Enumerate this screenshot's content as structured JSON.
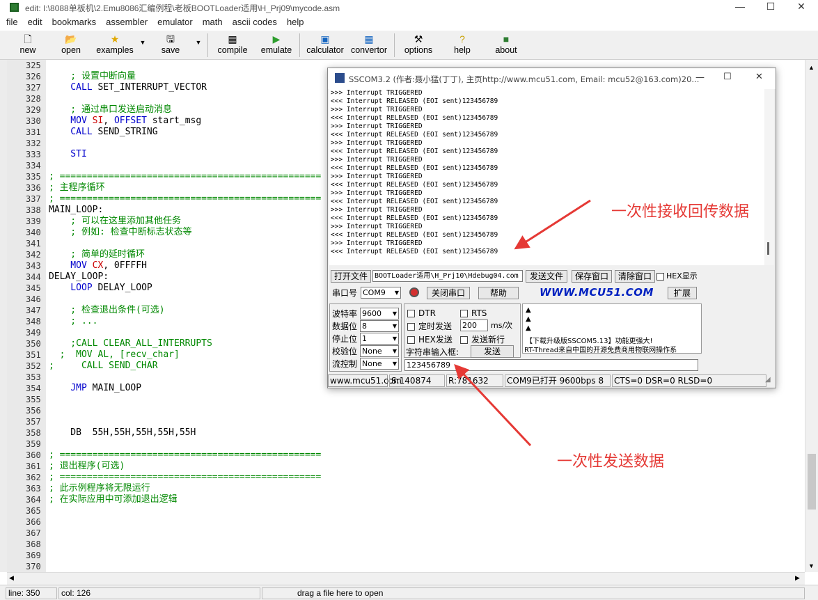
{
  "window": {
    "title": "edit: I:\\8088单板机\\2.Emu8086汇编例程\\老板BOOTLoader适用\\H_Prj09\\mycode.asm"
  },
  "menu": [
    "file",
    "edit",
    "bookmarks",
    "assembler",
    "emulator",
    "math",
    "ascii codes",
    "help"
  ],
  "toolbar": {
    "new": "new",
    "open": "open",
    "examples": "examples",
    "save": "save",
    "compile": "compile",
    "emulate": "emulate",
    "calculator": "calculator",
    "convertor": "convertor",
    "options": "options",
    "help": "help",
    "about": "about"
  },
  "line_numbers": [
    "325",
    "326",
    "327",
    "328",
    "329",
    "330",
    "331",
    "332",
    "333",
    "334",
    "335",
    "336",
    "337",
    "338",
    "339",
    "340",
    "341",
    "342",
    "343",
    "344",
    "345",
    "346",
    "347",
    "348",
    "349",
    "350",
    "351",
    "352",
    "353",
    "354",
    "355",
    "356",
    "357",
    "358",
    "359",
    "360",
    "361",
    "362",
    "363",
    "364",
    "365",
    "366",
    "367",
    "368",
    "369",
    "370"
  ],
  "code": [
    {
      "parts": []
    },
    {
      "parts": [
        {
          "t": "    ; 设置中断向量",
          "c": "cm"
        }
      ]
    },
    {
      "parts": [
        {
          "t": "    CALL ",
          "c": "kw"
        },
        {
          "t": "SET_INTERRUPT_VECTOR",
          "c": "lb"
        }
      ]
    },
    {
      "parts": []
    },
    {
      "parts": [
        {
          "t": "    ; 通过串口发送启动消息",
          "c": "cm"
        }
      ]
    },
    {
      "parts": [
        {
          "t": "    MOV ",
          "c": "kw"
        },
        {
          "t": "SI",
          "c": "rg"
        },
        {
          "t": ", ",
          "c": "lb"
        },
        {
          "t": "OFFSET ",
          "c": "kw"
        },
        {
          "t": "start_msg",
          "c": "lb"
        }
      ]
    },
    {
      "parts": [
        {
          "t": "    CALL ",
          "c": "kw"
        },
        {
          "t": "SEND_STRING",
          "c": "lb"
        }
      ]
    },
    {
      "parts": []
    },
    {
      "parts": [
        {
          "t": "    STI",
          "c": "kw"
        }
      ]
    },
    {
      "parts": []
    },
    {
      "parts": [
        {
          "t": "; ================================================",
          "c": "cm"
        }
      ]
    },
    {
      "parts": [
        {
          "t": "; 主程序循环",
          "c": "cm"
        }
      ]
    },
    {
      "parts": [
        {
          "t": "; ================================================",
          "c": "cm"
        }
      ]
    },
    {
      "parts": [
        {
          "t": "MAIN_LOOP:",
          "c": "lb"
        }
      ]
    },
    {
      "parts": [
        {
          "t": "    ; 可以在这里添加其他任务",
          "c": "cm"
        }
      ]
    },
    {
      "parts": [
        {
          "t": "    ; 例如: 检查中断标志状态等",
          "c": "cm"
        }
      ]
    },
    {
      "parts": []
    },
    {
      "parts": [
        {
          "t": "    ; 简单的延时循环",
          "c": "cm"
        }
      ]
    },
    {
      "parts": [
        {
          "t": "    MOV ",
          "c": "kw"
        },
        {
          "t": "CX",
          "c": "rg"
        },
        {
          "t": ", 0FFFFH",
          "c": "lb"
        }
      ]
    },
    {
      "parts": [
        {
          "t": "DELAY_LOOP:",
          "c": "lb"
        }
      ]
    },
    {
      "parts": [
        {
          "t": "    LOOP ",
          "c": "kw"
        },
        {
          "t": "DELAY_LOOP",
          "c": "lb"
        }
      ]
    },
    {
      "parts": []
    },
    {
      "parts": [
        {
          "t": "    ; 检查退出条件(可选)",
          "c": "cm"
        }
      ]
    },
    {
      "parts": [
        {
          "t": "    ; ...",
          "c": "cm"
        }
      ]
    },
    {
      "parts": []
    },
    {
      "parts": [
        {
          "t": "    ;CALL CLEAR_ALL_INTERRUPTS",
          "c": "cm"
        }
      ]
    },
    {
      "parts": [
        {
          "t": "  ;  MOV AL, [recv_char]",
          "c": "cm"
        }
      ]
    },
    {
      "parts": [
        {
          "t": ";     CALL SEND_CHAR",
          "c": "cm"
        }
      ]
    },
    {
      "parts": []
    },
    {
      "parts": [
        {
          "t": "    JMP ",
          "c": "kw"
        },
        {
          "t": "MAIN_LOOP",
          "c": "lb"
        }
      ]
    },
    {
      "parts": []
    },
    {
      "parts": []
    },
    {
      "parts": []
    },
    {
      "parts": [
        {
          "t": "    DB  55H,55H,55H,55H,55H",
          "c": "lb"
        }
      ]
    },
    {
      "parts": []
    },
    {
      "parts": [
        {
          "t": "; ================================================",
          "c": "cm"
        }
      ]
    },
    {
      "parts": [
        {
          "t": "; 退出程序(可选)",
          "c": "cm"
        }
      ]
    },
    {
      "parts": [
        {
          "t": "; ================================================",
          "c": "cm"
        }
      ]
    },
    {
      "parts": [
        {
          "t": "; 此示例程序将无限运行",
          "c": "cm"
        }
      ]
    },
    {
      "parts": [
        {
          "t": "; 在实际应用中可添加退出逻辑",
          "c": "cm"
        }
      ]
    },
    {
      "parts": []
    },
    {
      "parts": []
    },
    {
      "parts": []
    },
    {
      "parts": []
    },
    {
      "parts": []
    },
    {
      "parts": []
    }
  ],
  "status": {
    "line": "line: 350",
    "col": "col: 126",
    "hint": "drag a file here to open"
  },
  "sscom": {
    "title": "SSCOM3.2 (作者:聂小猛(丁丁), 主页http://www.mcu51.com,  Email: mcu52@163.com)20...",
    "log_lines": [
      ">>> Interrupt TRIGGERED",
      "<<< Interrupt RELEASED (EOI sent)123456789",
      ">>> Interrupt TRIGGERED",
      "<<< Interrupt RELEASED (EOI sent)123456789",
      ">>> Interrupt TRIGGERED",
      "<<< Interrupt RELEASED (EOI sent)123456789",
      ">>> Interrupt TRIGGERED",
      "<<< Interrupt RELEASED (EOI sent)123456789",
      ">>> Interrupt TRIGGERED",
      "<<< Interrupt RELEASED (EOI sent)123456789",
      ">>> Interrupt TRIGGERED",
      "<<< Interrupt RELEASED (EOI sent)123456789",
      ">>> Interrupt TRIGGERED",
      "<<< Interrupt RELEASED (EOI sent)123456789",
      ">>> Interrupt TRIGGERED",
      "<<< Interrupt RELEASED (EOI sent)123456789",
      ">>> Interrupt TRIGGERED",
      "<<< Interrupt RELEASED (EOI sent)123456789",
      ">>> Interrupt TRIGGERED",
      "<<< Interrupt RELEASED (EOI sent)123456789"
    ],
    "open_file": "打开文件",
    "file_path": "BOOTLoader适用\\H_Prj10\\Hdebug04.com",
    "send_file": "发送文件",
    "save_window": "保存窗口",
    "clear_window": "清除窗口",
    "hex_display": "HEX显示",
    "port_label": "串口号",
    "port_value": "COM9",
    "close_port": "关闭串口",
    "help": "帮助",
    "site": "WWW.MCU51.COM",
    "expand": "扩展",
    "baud_label": "波特率",
    "baud_value": "9600",
    "databits_label": "数据位",
    "databits_value": "8",
    "stopbits_label": "停止位",
    "stopbits_value": "1",
    "parity_label": "校验位",
    "parity_value": "None",
    "flow_label": "流控制",
    "flow_value": "None",
    "dtr": "DTR",
    "rts": "RTS",
    "timed_send": "定时发送",
    "interval": "200",
    "interval_unit": "ms/次",
    "hex_send": "HEX发送",
    "send_newline": "发送新行",
    "input_label": "字符串输入框:",
    "send": "发送",
    "input_value": "123456789",
    "info1": "【下载升级版SSCOM5.13】功能更强大!",
    "info2": "RT-Thread来自中国的开源免费商用物联网操作系",
    "status": {
      "site": "www.mcu51.com",
      "sent": "S:140874",
      "recv": "R:781632",
      "port": "COM9已打开  9600bps  8",
      "lines": "CTS=0 DSR=0 RLSD=0"
    }
  },
  "annotations": {
    "receive": "一次性接收回传数据",
    "send": "一次性发送数据"
  },
  "colors": {
    "keyword": "#0000cc",
    "register": "#cc0000",
    "comment": "#008800",
    "annotation": "#e53935"
  }
}
